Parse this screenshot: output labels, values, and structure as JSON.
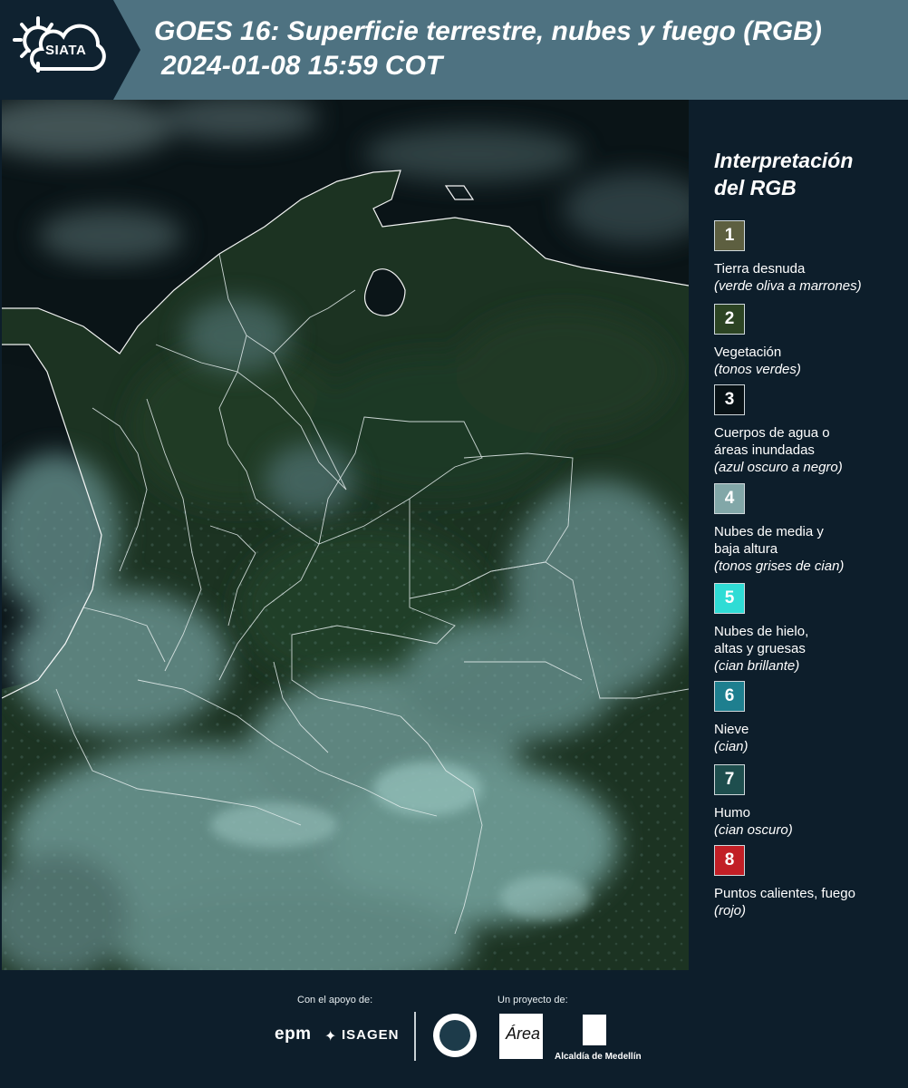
{
  "header": {
    "logo_text": "SIATA",
    "title": "GOES 16: Superficie terrestre, nubes y fuego (RGB)",
    "timestamp": "2024-01-08 15:59 COT"
  },
  "legend": {
    "title_line1": "Interpretación",
    "title_line2": "del RGB",
    "items": [
      {
        "number": "1",
        "color": "#5d5f40",
        "line1": "Tierra desnuda",
        "line2": "",
        "note": "(verde oliva a marrones)"
      },
      {
        "number": "2",
        "color": "#2c4423",
        "line1": "Vegetación",
        "line2": "",
        "note": "(tonos verdes)"
      },
      {
        "number": "3",
        "color": "#081216",
        "line1": "Cuerpos de agua o",
        "line2": "áreas inundadas",
        "note": "(azul oscuro a negro)"
      },
      {
        "number": "4",
        "color": "#82a7a8",
        "line1": "Nubes de media y",
        "line2": "baja altura",
        "note": "(tonos grises de cian)"
      },
      {
        "number": "5",
        "color": "#2fdcd5",
        "line1": "Nubes de hielo,",
        "line2": "altas y gruesas",
        "note": "(cian brillante)"
      },
      {
        "number": "6",
        "color": "#1e7f8f",
        "line1": "Nieve",
        "line2": "",
        "note": "(cian)"
      },
      {
        "number": "7",
        "color": "#1e4e4e",
        "line1": "Humo",
        "line2": "",
        "note": "(cian oscuro)"
      },
      {
        "number": "8",
        "color": "#c21f26",
        "line1": "Puntos calientes, fuego",
        "line2": "",
        "note": "(rojo)"
      }
    ]
  },
  "footer": {
    "support_label": "Con el apoyo de:",
    "project_label": "Un proyecto de:",
    "sponsor_epm": "epm",
    "sponsor_isagen": "ISAGEN",
    "area_logo_text": "Área",
    "alcaldia_text": "Alcaldía de Medellín"
  }
}
